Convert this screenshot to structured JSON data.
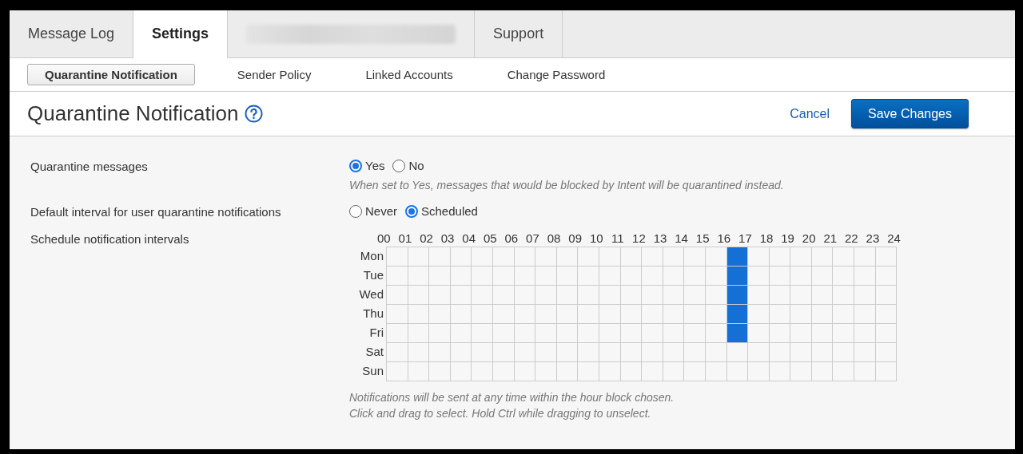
{
  "tabs": [
    {
      "kind": "text",
      "label": "Message Log",
      "selected": false
    },
    {
      "kind": "text",
      "label": "Settings",
      "selected": true
    },
    {
      "kind": "redacted",
      "selected": false
    },
    {
      "kind": "text",
      "label": "Support",
      "selected": false
    }
  ],
  "subnav": [
    {
      "label": "Quarantine Notification",
      "selected": true
    },
    {
      "label": "Sender Policy",
      "selected": false
    },
    {
      "label": "Linked Accounts",
      "selected": false
    },
    {
      "label": "Change Password",
      "selected": false
    }
  ],
  "header": {
    "title": "Quarantine Notification",
    "cancel": "Cancel",
    "save": "Save Changes"
  },
  "settings": [
    {
      "kind": "radio",
      "label": "Quarantine messages",
      "options": [
        {
          "label": "Yes",
          "selected": true
        },
        {
          "label": "No",
          "selected": false
        }
      ],
      "help": "When set to Yes, messages that would be blocked by Intent will be quarantined instead."
    },
    {
      "kind": "radio",
      "label": "Default interval for user quarantine notifications",
      "options": [
        {
          "label": "Never",
          "selected": false
        },
        {
          "label": "Scheduled",
          "selected": true
        }
      ]
    },
    {
      "kind": "schedule",
      "label": "Schedule notification intervals",
      "hours": [
        "00",
        "01",
        "02",
        "03",
        "04",
        "05",
        "06",
        "07",
        "08",
        "09",
        "10",
        "11",
        "12",
        "13",
        "14",
        "15",
        "16",
        "17",
        "18",
        "19",
        "20",
        "21",
        "22",
        "23",
        "24"
      ],
      "days": [
        {
          "label": "Mon",
          "cells": [
            false,
            false,
            false,
            false,
            false,
            false,
            false,
            false,
            false,
            false,
            false,
            false,
            false,
            false,
            false,
            false,
            true,
            false,
            false,
            false,
            false,
            false,
            false,
            false
          ]
        },
        {
          "label": "Tue",
          "cells": [
            false,
            false,
            false,
            false,
            false,
            false,
            false,
            false,
            false,
            false,
            false,
            false,
            false,
            false,
            false,
            false,
            true,
            false,
            false,
            false,
            false,
            false,
            false,
            false
          ]
        },
        {
          "label": "Wed",
          "cells": [
            false,
            false,
            false,
            false,
            false,
            false,
            false,
            false,
            false,
            false,
            false,
            false,
            false,
            false,
            false,
            false,
            true,
            false,
            false,
            false,
            false,
            false,
            false,
            false
          ]
        },
        {
          "label": "Thu",
          "cells": [
            false,
            false,
            false,
            false,
            false,
            false,
            false,
            false,
            false,
            false,
            false,
            false,
            false,
            false,
            false,
            false,
            true,
            false,
            false,
            false,
            false,
            false,
            false,
            false
          ]
        },
        {
          "label": "Fri",
          "cells": [
            false,
            false,
            false,
            false,
            false,
            false,
            false,
            false,
            false,
            false,
            false,
            false,
            false,
            false,
            false,
            false,
            true,
            false,
            false,
            false,
            false,
            false,
            false,
            false
          ]
        },
        {
          "label": "Sat",
          "cells": [
            false,
            false,
            false,
            false,
            false,
            false,
            false,
            false,
            false,
            false,
            false,
            false,
            false,
            false,
            false,
            false,
            false,
            false,
            false,
            false,
            false,
            false,
            false,
            false
          ]
        },
        {
          "label": "Sun",
          "cells": [
            false,
            false,
            false,
            false,
            false,
            false,
            false,
            false,
            false,
            false,
            false,
            false,
            false,
            false,
            false,
            false,
            false,
            false,
            false,
            false,
            false,
            false,
            false,
            false
          ]
        }
      ],
      "help": [
        "Notifications will be sent at any time within the hour block chosen.",
        "Click and drag to select. Hold Ctrl while dragging to unselect."
      ]
    }
  ]
}
